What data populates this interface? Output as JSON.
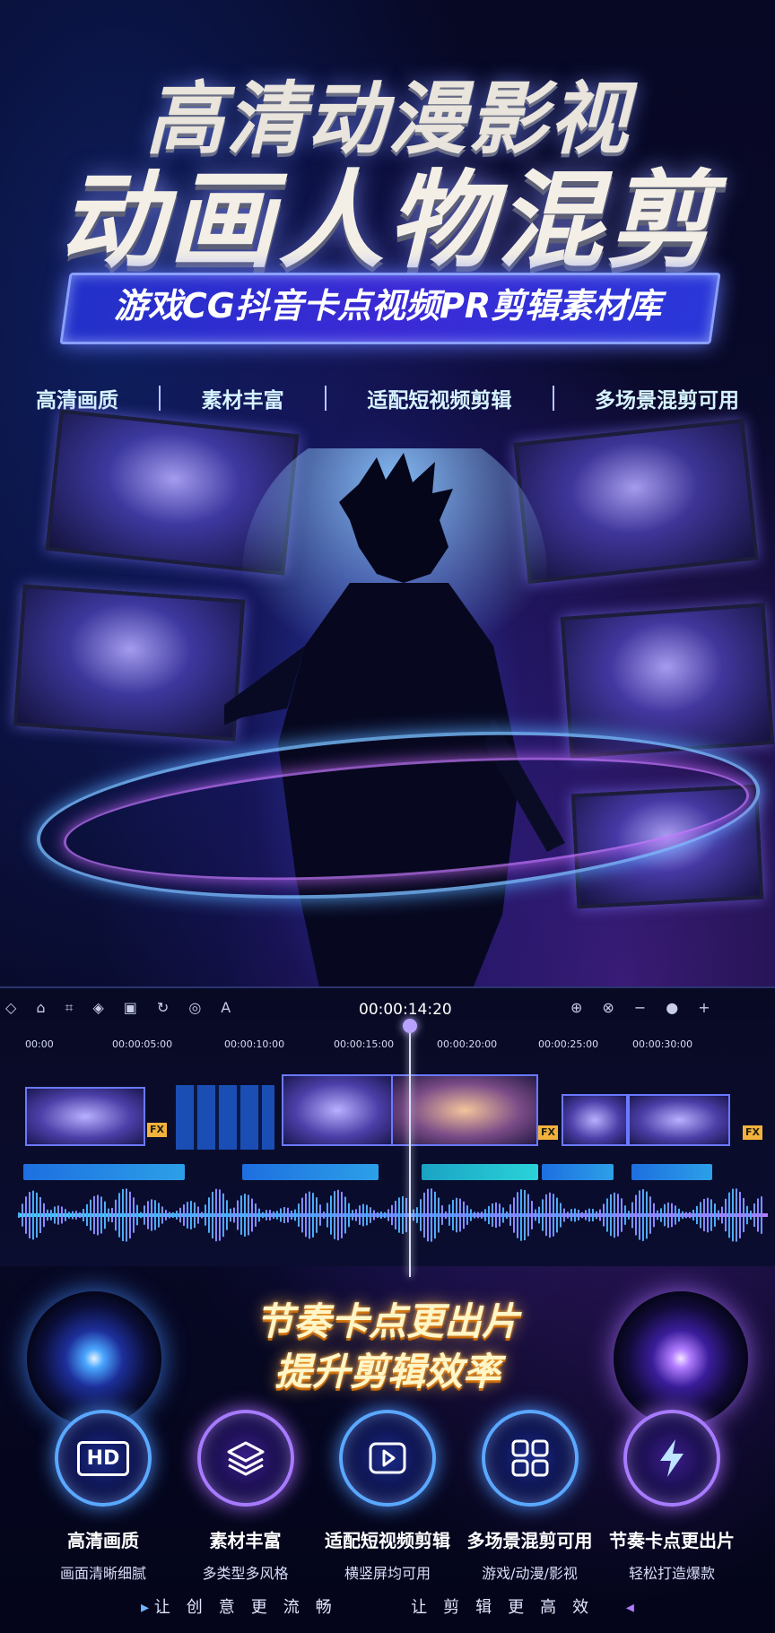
{
  "title": {
    "line1": "高清动漫影视",
    "line2": "动画人物混剪"
  },
  "banner": "游戏CG抖音卡点视频PR剪辑素材库",
  "features": [
    "高清画质",
    "素材丰富",
    "适配短视频剪辑",
    "多场景混剪可用"
  ],
  "editor": {
    "timecode": "00:00:14:20",
    "ruler": [
      "00:00",
      "00:00:05:00",
      "00:00:10:00",
      "00:00:15:00",
      "00:00:20:00",
      "00:00:25:00",
      "00:00:30:00"
    ],
    "fx_label": "FX"
  },
  "slogan": {
    "line1": "节奏卡点更出片",
    "line2": "提升剪辑效率"
  },
  "icons": [
    {
      "title": "高清画质",
      "sub": "画面清晰细腻",
      "icon": "hd-icon",
      "glyph": "HD"
    },
    {
      "title": "素材丰富",
      "sub": "多类型多风格",
      "icon": "layers-icon"
    },
    {
      "title": "适配短视频剪辑",
      "sub": "横竖屏均可用",
      "icon": "play-icon"
    },
    {
      "title": "多场景混剪可用",
      "sub": "游戏/动漫/影视",
      "icon": "grid-icon"
    },
    {
      "title": "节奏卡点更出片",
      "sub": "轻松打造爆款",
      "icon": "lightning-icon"
    }
  ],
  "footer": {
    "left": "让创意更流畅",
    "right": "让剪辑更高效"
  },
  "colors": {
    "accent_blue": "#3b5bff",
    "accent_purple": "#9b5cff",
    "slogan_gold": "#fff6c8"
  }
}
